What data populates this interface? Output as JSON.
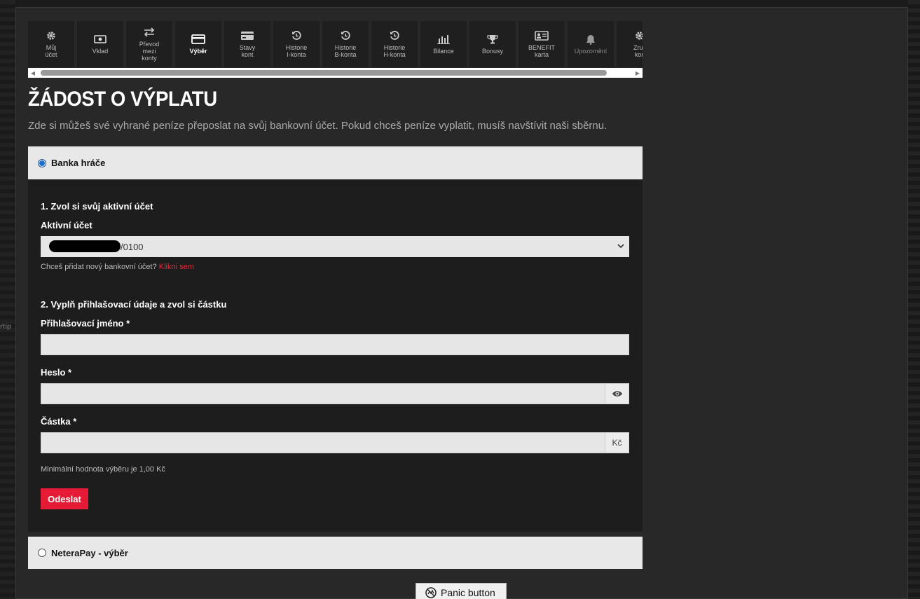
{
  "tabs": [
    {
      "label": "Můj\núčet",
      "icon": "gear-icon"
    },
    {
      "label": "Vklad",
      "icon": "cash-icon"
    },
    {
      "label": "Převod\nmezi\nkonty",
      "icon": "transfer-icon"
    },
    {
      "label": "Výběr",
      "icon": "card-icon",
      "active": true
    },
    {
      "label": "Stavy\nkont",
      "icon": "card-outline-icon"
    },
    {
      "label": "Historie\nI-konta",
      "icon": "history-icon"
    },
    {
      "label": "Historie\nB-konta",
      "icon": "history-icon"
    },
    {
      "label": "Historie\nH-konta",
      "icon": "history-icon"
    },
    {
      "label": "Bilance",
      "icon": "chart-bars-icon"
    },
    {
      "label": "Bonusy",
      "icon": "trophy-icon"
    },
    {
      "label": "BENEFIT\nkarta",
      "icon": "id-card-icon"
    },
    {
      "label": "Upozornění",
      "icon": "bell-icon",
      "dim": true
    },
    {
      "label": "Zruš\nkon",
      "icon": "gear-icon"
    }
  ],
  "page": {
    "title": "ŽÁDOST O VÝPLATU",
    "intro": "Zde si můžeš své vyhrané peníze přeposlat na svůj bankovní účet. Pokud chceš peníze vyplatit, musíš navštívit naši sběrnu."
  },
  "methods": {
    "bank": "Banka hráče",
    "neterapay": "NeteraPay - výběr"
  },
  "form": {
    "step1": "1. Zvol si svůj aktivní účet",
    "active_account_label": "Aktivní účet",
    "account_value": "/0100",
    "add_account_hint": "Chceš přidat nový bankovní účet?",
    "add_account_link": "Klikni sem",
    "step2": "2. Vyplň přihlašovací údaje a zvol si částku",
    "login_label": "Přihlašovací jméno *",
    "password_label": "Heslo *",
    "amount_label": "Částka *",
    "currency": "Kč",
    "min_hint": "Minimální hodnota výběru je 1,00 Kč",
    "submit": "Odeslat"
  },
  "panic": "Panic button",
  "bg_text": "rtip"
}
